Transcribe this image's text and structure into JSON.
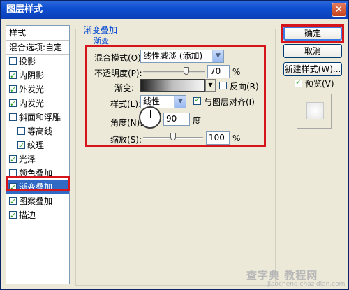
{
  "window": {
    "title": "图层样式",
    "close_label": "×"
  },
  "left": {
    "header": "样式",
    "blend_options": "混合选项:自定",
    "items": [
      {
        "label": "投影",
        "checked": false
      },
      {
        "label": "内阴影",
        "checked": true
      },
      {
        "label": "外发光",
        "checked": true
      },
      {
        "label": "内发光",
        "checked": true
      },
      {
        "label": "斜面和浮雕",
        "checked": false
      },
      {
        "label": "等高线",
        "checked": false
      },
      {
        "label": "纹理",
        "checked": true
      },
      {
        "label": "光泽",
        "checked": true
      },
      {
        "label": "颜色叠加",
        "checked": false
      },
      {
        "label": "渐变叠加",
        "checked": true,
        "selected": true
      },
      {
        "label": "图案叠加",
        "checked": true
      },
      {
        "label": "描边",
        "checked": true
      }
    ]
  },
  "panel": {
    "group_title": "渐变叠加",
    "sub_title": "渐变",
    "blend_mode_label": "混合模式(O):",
    "blend_mode_value": "线性减淡 (添加)",
    "opacity_label": "不透明度(P):",
    "opacity_value": "70",
    "opacity_unit": "%",
    "gradient_label": "渐变:",
    "reverse_label": "反向(R)",
    "style_label": "样式(L):",
    "style_value": "线性",
    "align_label": "与图层对齐(I)",
    "angle_label": "角度(N):",
    "angle_value": "90",
    "angle_unit": "度",
    "scale_label": "缩放(S):",
    "scale_value": "100",
    "scale_unit": "%",
    "opacity_level": 0.7,
    "scale_level": 0.5
  },
  "buttons": {
    "ok": "确定",
    "cancel": "取消",
    "new_style": "新建样式(W)...",
    "preview_label": "预览(V)",
    "preview_checked": true
  },
  "watermark": {
    "text": "查字典 教程网",
    "url": "jiaocheng.chazidian.com"
  },
  "colors": {
    "highlight_box": "#d5141c",
    "selection": "#316ac5",
    "title_bar": "#0f4fd0"
  }
}
